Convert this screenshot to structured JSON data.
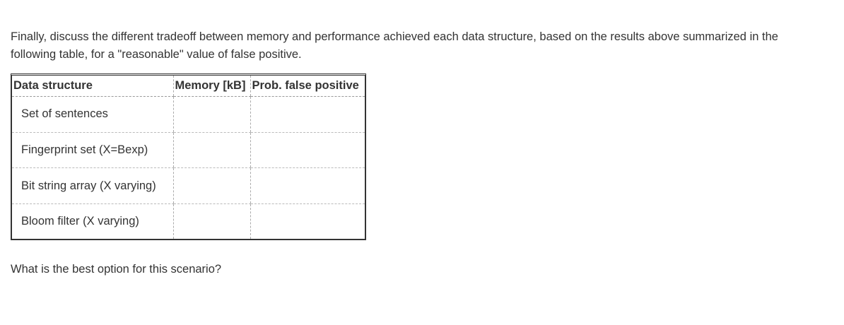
{
  "intro": {
    "line1": "Finally, discuss the different tradeoff between memory and performance achieved each data structure, based on the results above summarized in the",
    "line2": "following table, for a \"reasonable\" value of false positive."
  },
  "table": {
    "headers": [
      "Data structure",
      "Memory [kB]",
      "Prob. false positive"
    ],
    "rows": [
      {
        "name": "Set of sentences",
        "memory": "",
        "prob": ""
      },
      {
        "name": "Fingerprint set (X=Bexp)",
        "memory": "",
        "prob": ""
      },
      {
        "name": "Bit string array (X varying)",
        "memory": "",
        "prob": ""
      },
      {
        "name": "Bloom filter (X varying)",
        "memory": "",
        "prob": ""
      }
    ]
  },
  "question": "What is the best option for this scenario?"
}
